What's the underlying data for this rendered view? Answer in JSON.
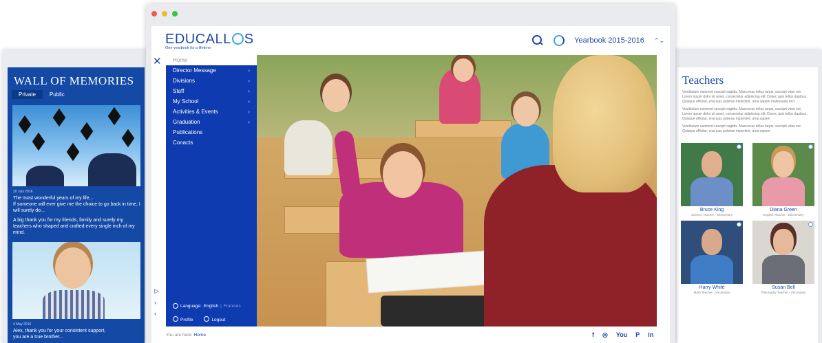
{
  "colors": {
    "brand_blue": "#1d49a7",
    "nav_blue": "#0e3bb0",
    "accent_cyan": "#38a6e0",
    "wall_blue": "#144aa6"
  },
  "window_dots": [
    {
      "name": "close",
      "color": "#ee5b55"
    },
    {
      "name": "minimize",
      "color": "#f2bb2f"
    },
    {
      "name": "maximize",
      "color": "#39c446"
    }
  ],
  "wall": {
    "title": "WALL OF MEMORIES",
    "tabs": [
      {
        "label": "Private",
        "active": true
      },
      {
        "label": "Public",
        "active": false
      }
    ],
    "post1": {
      "date": "20 July 2016",
      "line1": "The most wonderful years of my life...",
      "line2": "If someone will ever give me the choice to go back in time, I will surely do...",
      "line3": "A big thank you for my friends, family and surely my teachers who shaped and crafted every single inch of my mind."
    },
    "post2": {
      "date": "4 May 2016",
      "line1": "Alex, thank you for your consistent support,",
      "line2": "you are a true brother..."
    }
  },
  "teachers": {
    "title": "Teachers",
    "para1": "Vestibulum euismod suscipit sagittis. Maecenas tellus turpis, suscipit vitae est. Lorem ipsum dolor sit amet, consectetur adipiscing elit. Donec quis tellus dapibus. Quisque efficitur, erat quis pulvinar imperdiet, urna sapien malesuada orci.",
    "para2": "Vestibulum euismod suscipit sagittis. Maecenas tellus turpis, suscipit vitae est. Lorem ipsum dolor sit amet, consectetur adipiscing elit. Donec quis tellus dapibus. Quisque efficitur, erat quis pulvinar imperdiet, urna sapien",
    "para3": "Vestibulum euismod suscipit sagittis. Maecenas tellus turpis, suscipit vitae est. Quisque efficitur, erat quis pulvinar imperdiet, urna sapien",
    "cards": [
      {
        "name": "Bruce King",
        "role": "Science Teacher - Elementary"
      },
      {
        "name": "Diana Green",
        "role": "English Teacher - Elementary"
      },
      {
        "name": "Harry White",
        "role": "Math Teacher - Secondary"
      },
      {
        "name": "Susan Bell",
        "role": "Philosophy Teacher - Secondary"
      }
    ]
  },
  "header": {
    "logo_text_left": "EDUCALL",
    "logo_text_right": "S",
    "tagline": "One yearbook for a lifetime",
    "yearbook": "Yearbook 2015-2016",
    "updown": "⌃⌄"
  },
  "nav": {
    "home": "Home",
    "items": [
      {
        "label": "Director Message",
        "has_children": true
      },
      {
        "label": "Divisions",
        "has_children": true
      },
      {
        "label": "Staff",
        "has_children": true
      },
      {
        "label": "My School",
        "has_children": true
      },
      {
        "label": "Activities & Events",
        "has_children": true
      },
      {
        "label": "Graduation",
        "has_children": true
      },
      {
        "label": "Publications",
        "has_children": false
      },
      {
        "label": "Conacts",
        "has_children": false
      }
    ],
    "language_label": "Language:",
    "language_current": "English",
    "language_sep": "|",
    "language_alt": "Francais",
    "profile": "Profile",
    "logout": "Logout"
  },
  "breadcrumb": {
    "prefix": "You are here:",
    "current": "Home"
  },
  "socials": [
    {
      "icon": "facebook-icon",
      "glyph": "f"
    },
    {
      "icon": "instagram-icon",
      "glyph": "◎"
    },
    {
      "icon": "youtube-icon",
      "glyph": "You"
    },
    {
      "icon": "pinterest-icon",
      "glyph": "P"
    },
    {
      "icon": "linkedin-icon",
      "glyph": "in"
    }
  ]
}
